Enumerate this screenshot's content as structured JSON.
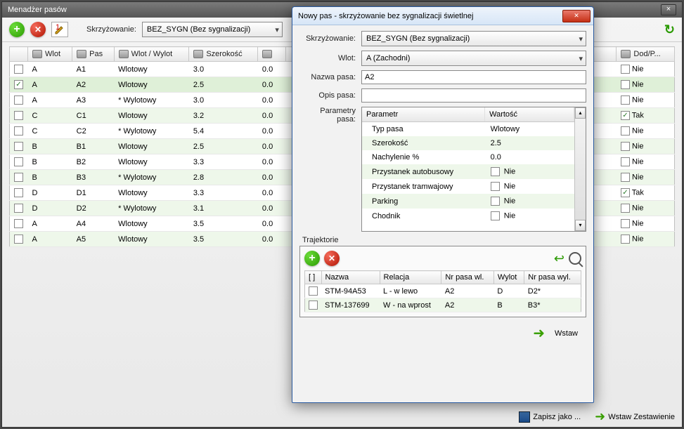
{
  "window": {
    "title": "Menadżer pasów"
  },
  "toolbar": {
    "skrzyzowanie_label": "Skrzyżowanie:",
    "skrzyzowanie_value": "BEZ_SYGN (Bez sygnalizacji)"
  },
  "grid": {
    "headers": {
      "chk": "",
      "wlot": "Wlot",
      "pas": "Pas",
      "wlot_wylot": "Wlot / Wylot",
      "szer": "Szerokość",
      "dod": "Dod/P..."
    },
    "rows": [
      {
        "wlot": "A",
        "pas": "A1",
        "ww": "Wlotowy",
        "sz": "3.0",
        "ex": "0.0",
        "dod": "Nie",
        "checked": false
      },
      {
        "wlot": "A",
        "pas": "A2",
        "ww": "Wlotowy",
        "sz": "2.5",
        "ex": "0.0",
        "dod": "Nie",
        "checked": true
      },
      {
        "wlot": "A",
        "pas": "A3",
        "ww": "* Wylotowy",
        "sz": "3.0",
        "ex": "0.0",
        "dod": "Nie",
        "checked": false
      },
      {
        "wlot": "C",
        "pas": "C1",
        "ww": "Wlotowy",
        "sz": "3.2",
        "ex": "0.0",
        "dod": "Tak",
        "checked": false
      },
      {
        "wlot": "C",
        "pas": "C2",
        "ww": "* Wylotowy",
        "sz": "5.4",
        "ex": "0.0",
        "dod": "Nie",
        "checked": false
      },
      {
        "wlot": "B",
        "pas": "B1",
        "ww": "Wlotowy",
        "sz": "2.5",
        "ex": "0.0",
        "dod": "Nie",
        "checked": false
      },
      {
        "wlot": "B",
        "pas": "B2",
        "ww": "Wlotowy",
        "sz": "3.3",
        "ex": "0.0",
        "dod": "Nie",
        "checked": false
      },
      {
        "wlot": "B",
        "pas": "B3",
        "ww": "* Wylotowy",
        "sz": "2.8",
        "ex": "0.0",
        "dod": "Nie",
        "checked": false
      },
      {
        "wlot": "D",
        "pas": "D1",
        "ww": "Wlotowy",
        "sz": "3.3",
        "ex": "0.0",
        "dod": "Tak",
        "checked": false
      },
      {
        "wlot": "D",
        "pas": "D2",
        "ww": "* Wylotowy",
        "sz": "3.1",
        "ex": "0.0",
        "dod": "Nie",
        "checked": false
      },
      {
        "wlot": "A",
        "pas": "A4",
        "ww": "Wlotowy",
        "sz": "3.5",
        "ex": "0.0",
        "dod": "Nie",
        "checked": false
      },
      {
        "wlot": "A",
        "pas": "A5",
        "ww": "Wlotowy",
        "sz": "3.5",
        "ex": "0.0",
        "dod": "Nie",
        "checked": false
      }
    ]
  },
  "footer": {
    "zapisz": "Zapisz jako ...",
    "wstaw_zest": "Wstaw Zestawienie"
  },
  "dialog": {
    "title": "Nowy pas - skrzyżowanie bez sygnalizacji świetlnej",
    "labels": {
      "skrzyzowanie": "Skrzyżowanie:",
      "wlot": "Wlot:",
      "nazwa": "Nazwa pasa:",
      "opis": "Opis pasa:",
      "param": "Parametry pasa:",
      "traj": "Trajektorie"
    },
    "values": {
      "skrzyzowanie": "BEZ_SYGN (Bez sygnalizacji)",
      "wlot": "A (Zachodni)",
      "nazwa": "A2",
      "opis": ""
    },
    "param_headers": {
      "p": "Parametr",
      "w": "Wartość"
    },
    "params": [
      {
        "p": "Typ pasa",
        "w": "Wlotowy",
        "chk": null
      },
      {
        "p": "Szerokość",
        "w": "2.5",
        "chk": null
      },
      {
        "p": "Nachylenie %",
        "w": "0.0",
        "chk": null
      },
      {
        "p": "Przystanek autobusowy",
        "w": "Nie",
        "chk": false
      },
      {
        "p": "Przystanek tramwajowy",
        "w": "Nie",
        "chk": false
      },
      {
        "p": "Parking",
        "w": "Nie",
        "chk": false
      },
      {
        "p": "Chodnik",
        "w": "Nie",
        "chk": false
      }
    ],
    "traj_headers": {
      "chk": "[ ]",
      "nazwa": "Nazwa",
      "rel": "Relacja",
      "nrwl": "Nr pasa wl.",
      "wylot": "Wylot",
      "nrwyl": "Nr pasa wyl."
    },
    "traj_rows": [
      {
        "nazwa": "STM-94A53",
        "rel": "L - w lewo",
        "nrwl": "A2",
        "wylot": "D",
        "nrwyl": "D2*"
      },
      {
        "nazwa": "STM-137699",
        "rel": "W - na wprost",
        "nrwl": "A2",
        "wylot": "B",
        "nrwyl": "B3*"
      }
    ],
    "wstaw_btn": "Wstaw"
  }
}
